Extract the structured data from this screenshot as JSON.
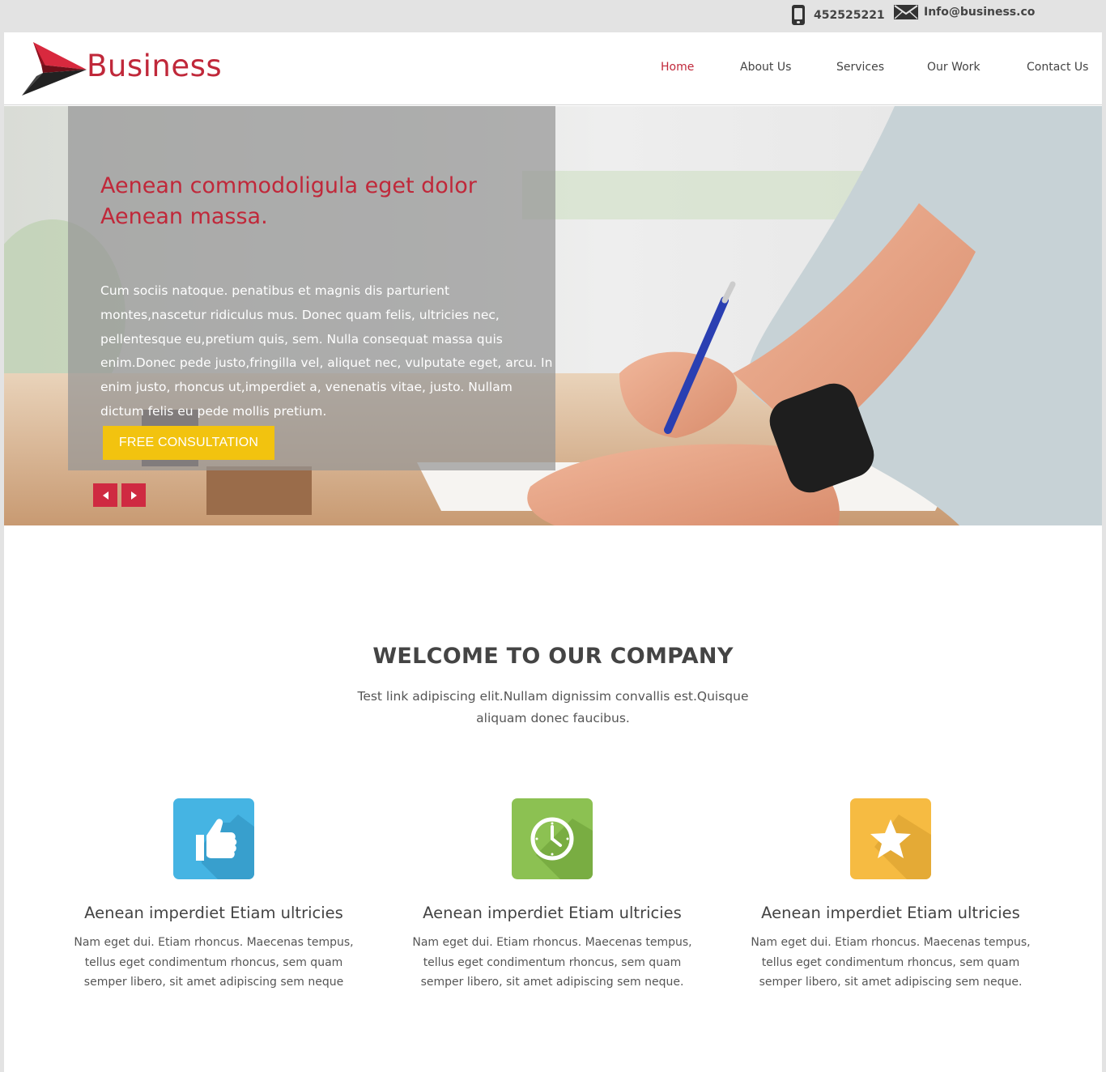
{
  "contact": {
    "phone": "452525221",
    "email": "Info@business.co"
  },
  "brand": {
    "name": "Business",
    "color": "#c0283a"
  },
  "nav": {
    "items": [
      {
        "label": "Home",
        "active": true
      },
      {
        "label": "About Us",
        "active": false
      },
      {
        "label": "Services",
        "active": false
      },
      {
        "label": "Our Work",
        "active": false
      },
      {
        "label": "Contact Us",
        "active": false
      }
    ]
  },
  "hero": {
    "title": "Aenean commodoligula eget dolor Aenean massa.",
    "body": "Cum sociis natoque. penatibus et magnis dis parturient montes,nascetur ridiculus mus. Donec quam felis, ultricies nec, pellentesque eu,pretium quis, sem. Nulla consequat massa quis enim.Donec pede justo,fringilla vel, aliquet nec, vulputate eget, arcu. In enim justo, rhoncus ut,imperdiet a, venenatis vitae, justo. Nullam dictum felis eu pede mollis pretium.",
    "cta_label": "FREE CONSULTATION",
    "cta_color": "#f2c30f",
    "slider_color": "#cf2a41"
  },
  "welcome": {
    "title": "WELCOME TO OUR COMPANY",
    "text": "Test link adipiscing elit.Nullam dignissim convallis est.Quisque aliquam donec faucibus."
  },
  "features": [
    {
      "icon": "thumbs-up-icon",
      "color": "#45b4e3",
      "title": "Aenean imperdiet Etiam ultricies",
      "text": "Nam eget dui. Etiam rhoncus. Maecenas tempus, tellus eget condimentum rhoncus, sem quam semper libero, sit amet adipiscing sem neque"
    },
    {
      "icon": "clock-icon",
      "color": "#8cc152",
      "title": "Aenean imperdiet Etiam ultricies",
      "text": "Nam eget dui. Etiam rhoncus. Maecenas tempus, tellus eget condimentum rhoncus, sem quam semper libero, sit amet adipiscing sem neque."
    },
    {
      "icon": "star-icon",
      "color": "#f6bb42",
      "title": "Aenean imperdiet Etiam ultricies",
      "text": "Nam eget dui. Etiam rhoncus. Maecenas tempus, tellus eget condimentum rhoncus, sem quam semper libero, sit amet adipiscing sem neque."
    }
  ]
}
